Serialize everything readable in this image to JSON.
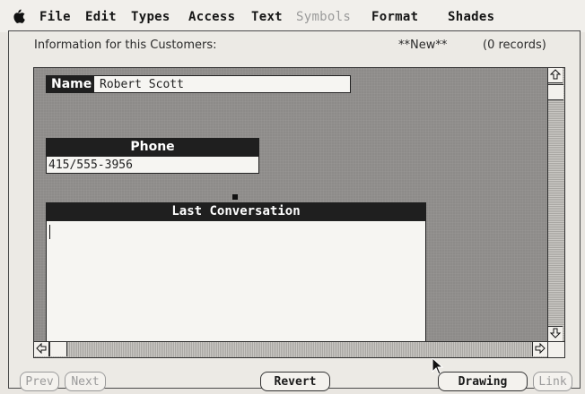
{
  "menubar": {
    "apple": "",
    "items": [
      {
        "label": "File",
        "enabled": true
      },
      {
        "label": "Edit",
        "enabled": true
      },
      {
        "label": "Types",
        "enabled": true
      },
      {
        "label": "Access",
        "enabled": true
      },
      {
        "label": "Text",
        "enabled": true
      },
      {
        "label": "Symbols",
        "enabled": false
      },
      {
        "label": "Format",
        "enabled": true
      },
      {
        "label": "Shades",
        "enabled": true
      }
    ]
  },
  "window": {
    "info_label": "Information for this Customers:",
    "new_label": "**New**",
    "records_label": "(0 records)"
  },
  "form": {
    "name_label": "Name",
    "name_value": "Robert Scott",
    "phone_label": "Phone",
    "phone_value": "415/555-3956",
    "conversation_label": "Last Conversation",
    "conversation_value": ""
  },
  "buttons": {
    "prev": "Prev",
    "next": "Next",
    "revert": "Revert",
    "drawing": "Drawing",
    "link": "Link"
  },
  "icons": {
    "apple": "apple-icon",
    "scroll_up": "arrow-up-icon",
    "scroll_down": "arrow-down-icon",
    "scroll_left": "arrow-left-icon",
    "scroll_right": "arrow-right-icon",
    "cursor": "mouse-pointer-icon"
  }
}
